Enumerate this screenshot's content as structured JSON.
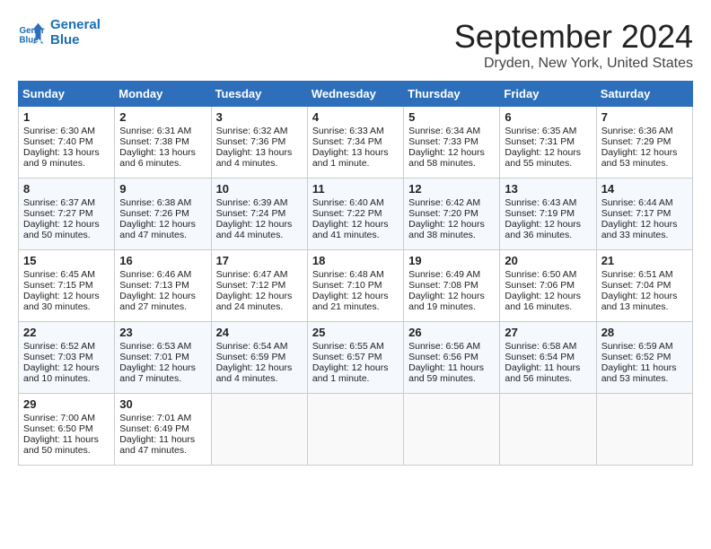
{
  "header": {
    "logo_line1": "General",
    "logo_line2": "Blue",
    "month": "September 2024",
    "location": "Dryden, New York, United States"
  },
  "weekdays": [
    "Sunday",
    "Monday",
    "Tuesday",
    "Wednesday",
    "Thursday",
    "Friday",
    "Saturday"
  ],
  "weeks": [
    [
      {
        "day": 1,
        "lines": [
          "Sunrise: 6:30 AM",
          "Sunset: 7:40 PM",
          "Daylight: 13 hours",
          "and 9 minutes."
        ]
      },
      {
        "day": 2,
        "lines": [
          "Sunrise: 6:31 AM",
          "Sunset: 7:38 PM",
          "Daylight: 13 hours",
          "and 6 minutes."
        ]
      },
      {
        "day": 3,
        "lines": [
          "Sunrise: 6:32 AM",
          "Sunset: 7:36 PM",
          "Daylight: 13 hours",
          "and 4 minutes."
        ]
      },
      {
        "day": 4,
        "lines": [
          "Sunrise: 6:33 AM",
          "Sunset: 7:34 PM",
          "Daylight: 13 hours",
          "and 1 minute."
        ]
      },
      {
        "day": 5,
        "lines": [
          "Sunrise: 6:34 AM",
          "Sunset: 7:33 PM",
          "Daylight: 12 hours",
          "and 58 minutes."
        ]
      },
      {
        "day": 6,
        "lines": [
          "Sunrise: 6:35 AM",
          "Sunset: 7:31 PM",
          "Daylight: 12 hours",
          "and 55 minutes."
        ]
      },
      {
        "day": 7,
        "lines": [
          "Sunrise: 6:36 AM",
          "Sunset: 7:29 PM",
          "Daylight: 12 hours",
          "and 53 minutes."
        ]
      }
    ],
    [
      {
        "day": 8,
        "lines": [
          "Sunrise: 6:37 AM",
          "Sunset: 7:27 PM",
          "Daylight: 12 hours",
          "and 50 minutes."
        ]
      },
      {
        "day": 9,
        "lines": [
          "Sunrise: 6:38 AM",
          "Sunset: 7:26 PM",
          "Daylight: 12 hours",
          "and 47 minutes."
        ]
      },
      {
        "day": 10,
        "lines": [
          "Sunrise: 6:39 AM",
          "Sunset: 7:24 PM",
          "Daylight: 12 hours",
          "and 44 minutes."
        ]
      },
      {
        "day": 11,
        "lines": [
          "Sunrise: 6:40 AM",
          "Sunset: 7:22 PM",
          "Daylight: 12 hours",
          "and 41 minutes."
        ]
      },
      {
        "day": 12,
        "lines": [
          "Sunrise: 6:42 AM",
          "Sunset: 7:20 PM",
          "Daylight: 12 hours",
          "and 38 minutes."
        ]
      },
      {
        "day": 13,
        "lines": [
          "Sunrise: 6:43 AM",
          "Sunset: 7:19 PM",
          "Daylight: 12 hours",
          "and 36 minutes."
        ]
      },
      {
        "day": 14,
        "lines": [
          "Sunrise: 6:44 AM",
          "Sunset: 7:17 PM",
          "Daylight: 12 hours",
          "and 33 minutes."
        ]
      }
    ],
    [
      {
        "day": 15,
        "lines": [
          "Sunrise: 6:45 AM",
          "Sunset: 7:15 PM",
          "Daylight: 12 hours",
          "and 30 minutes."
        ]
      },
      {
        "day": 16,
        "lines": [
          "Sunrise: 6:46 AM",
          "Sunset: 7:13 PM",
          "Daylight: 12 hours",
          "and 27 minutes."
        ]
      },
      {
        "day": 17,
        "lines": [
          "Sunrise: 6:47 AM",
          "Sunset: 7:12 PM",
          "Daylight: 12 hours",
          "and 24 minutes."
        ]
      },
      {
        "day": 18,
        "lines": [
          "Sunrise: 6:48 AM",
          "Sunset: 7:10 PM",
          "Daylight: 12 hours",
          "and 21 minutes."
        ]
      },
      {
        "day": 19,
        "lines": [
          "Sunrise: 6:49 AM",
          "Sunset: 7:08 PM",
          "Daylight: 12 hours",
          "and 19 minutes."
        ]
      },
      {
        "day": 20,
        "lines": [
          "Sunrise: 6:50 AM",
          "Sunset: 7:06 PM",
          "Daylight: 12 hours",
          "and 16 minutes."
        ]
      },
      {
        "day": 21,
        "lines": [
          "Sunrise: 6:51 AM",
          "Sunset: 7:04 PM",
          "Daylight: 12 hours",
          "and 13 minutes."
        ]
      }
    ],
    [
      {
        "day": 22,
        "lines": [
          "Sunrise: 6:52 AM",
          "Sunset: 7:03 PM",
          "Daylight: 12 hours",
          "and 10 minutes."
        ]
      },
      {
        "day": 23,
        "lines": [
          "Sunrise: 6:53 AM",
          "Sunset: 7:01 PM",
          "Daylight: 12 hours",
          "and 7 minutes."
        ]
      },
      {
        "day": 24,
        "lines": [
          "Sunrise: 6:54 AM",
          "Sunset: 6:59 PM",
          "Daylight: 12 hours",
          "and 4 minutes."
        ]
      },
      {
        "day": 25,
        "lines": [
          "Sunrise: 6:55 AM",
          "Sunset: 6:57 PM",
          "Daylight: 12 hours",
          "and 1 minute."
        ]
      },
      {
        "day": 26,
        "lines": [
          "Sunrise: 6:56 AM",
          "Sunset: 6:56 PM",
          "Daylight: 11 hours",
          "and 59 minutes."
        ]
      },
      {
        "day": 27,
        "lines": [
          "Sunrise: 6:58 AM",
          "Sunset: 6:54 PM",
          "Daylight: 11 hours",
          "and 56 minutes."
        ]
      },
      {
        "day": 28,
        "lines": [
          "Sunrise: 6:59 AM",
          "Sunset: 6:52 PM",
          "Daylight: 11 hours",
          "and 53 minutes."
        ]
      }
    ],
    [
      {
        "day": 29,
        "lines": [
          "Sunrise: 7:00 AM",
          "Sunset: 6:50 PM",
          "Daylight: 11 hours",
          "and 50 minutes."
        ]
      },
      {
        "day": 30,
        "lines": [
          "Sunrise: 7:01 AM",
          "Sunset: 6:49 PM",
          "Daylight: 11 hours",
          "and 47 minutes."
        ]
      },
      null,
      null,
      null,
      null,
      null
    ]
  ]
}
